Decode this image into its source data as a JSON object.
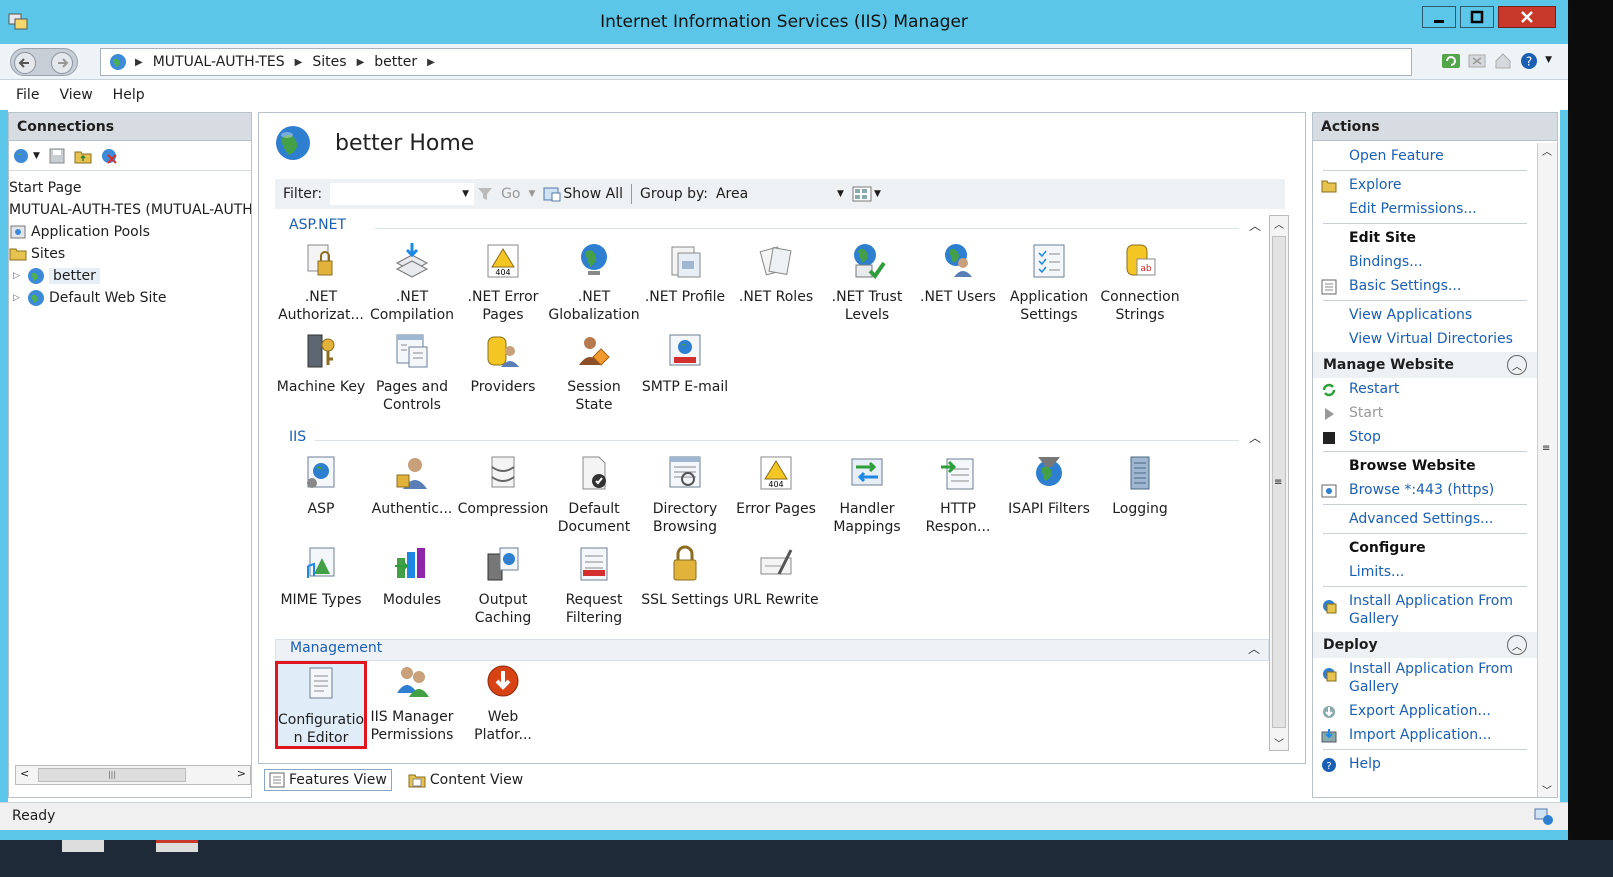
{
  "window": {
    "title": "Internet Information Services (IIS) Manager",
    "brand_color": "#5bc6e8",
    "close_color": "#c8392b"
  },
  "address": {
    "crumbs": [
      "MUTUAL-AUTH-TES",
      "Sites",
      "better"
    ]
  },
  "menu": [
    "File",
    "View",
    "Help"
  ],
  "connections": {
    "title": "Connections",
    "tree": [
      {
        "label": "Start Page",
        "icon": "start-page-icon",
        "indent": 0
      },
      {
        "label": "MUTUAL-AUTH-TES (MUTUAL-AUTH",
        "icon": "server-icon",
        "indent": 0
      },
      {
        "label": "Application Pools",
        "icon": "app-pools-icon",
        "indent": 1
      },
      {
        "label": "Sites",
        "icon": "sites-icon",
        "indent": 1
      },
      {
        "label": "better",
        "icon": "globe-icon",
        "indent": 2
      },
      {
        "label": "Default Web Site",
        "icon": "globe-icon",
        "indent": 2
      }
    ]
  },
  "home": {
    "title": "better Home",
    "filter_label": "Filter:",
    "go_label": "Go",
    "show_all_label": "Show All",
    "group_by_label": "Group by:",
    "group_by_value": "Area"
  },
  "sections": {
    "aspnet": {
      "title": "ASP.NET",
      "features": [
        {
          "line1": ".NET",
          "line2": "Authorizat..."
        },
        {
          "line1": ".NET",
          "line2": "Compilation"
        },
        {
          "line1": ".NET Error",
          "line2": "Pages"
        },
        {
          "line1": ".NET",
          "line2": "Globalization"
        },
        {
          "line1": ".NET Profile",
          "line2": ""
        },
        {
          "line1": ".NET Roles",
          "line2": ""
        },
        {
          "line1": ".NET Trust",
          "line2": "Levels"
        },
        {
          "line1": ".NET Users",
          "line2": ""
        },
        {
          "line1": "Application",
          "line2": "Settings"
        },
        {
          "line1": "Connection",
          "line2": "Strings"
        },
        {
          "line1": "Machine Key",
          "line2": ""
        },
        {
          "line1": "Pages and",
          "line2": "Controls"
        },
        {
          "line1": "Providers",
          "line2": ""
        },
        {
          "line1": "Session State",
          "line2": ""
        },
        {
          "line1": "SMTP E-mail",
          "line2": ""
        }
      ]
    },
    "iis": {
      "title": "IIS",
      "features": [
        {
          "line1": "ASP",
          "line2": ""
        },
        {
          "line1": "Authentic...",
          "line2": ""
        },
        {
          "line1": "Compression",
          "line2": ""
        },
        {
          "line1": "Default",
          "line2": "Document"
        },
        {
          "line1": "Directory",
          "line2": "Browsing"
        },
        {
          "line1": "Error Pages",
          "line2": ""
        },
        {
          "line1": "Handler",
          "line2": "Mappings"
        },
        {
          "line1": "HTTP",
          "line2": "Respon..."
        },
        {
          "line1": "ISAPI Filters",
          "line2": ""
        },
        {
          "line1": "Logging",
          "line2": ""
        },
        {
          "line1": "MIME Types",
          "line2": ""
        },
        {
          "line1": "Modules",
          "line2": ""
        },
        {
          "line1": "Output",
          "line2": "Caching"
        },
        {
          "line1": "Request",
          "line2": "Filtering"
        },
        {
          "line1": "SSL Settings",
          "line2": ""
        },
        {
          "line1": "URL Rewrite",
          "line2": ""
        }
      ]
    },
    "management": {
      "title": "Management",
      "features": [
        {
          "line1": "Configuratio",
          "line2": "n Editor"
        },
        {
          "line1": "IIS Manager",
          "line2": "Permissions"
        },
        {
          "line1": "Web",
          "line2": "Platfor..."
        }
      ]
    }
  },
  "tabs": {
    "features": "Features View",
    "content": "Content View"
  },
  "actions": {
    "title": "Actions",
    "open_feature": "Open Feature",
    "explore": "Explore",
    "edit_permissions": "Edit Permissions...",
    "edit_site": "Edit Site",
    "bindings": "Bindings...",
    "basic_settings": "Basic Settings...",
    "view_applications": "View Applications",
    "view_virtual_directories": "View Virtual Directories",
    "manage_website": "Manage Website",
    "restart": "Restart",
    "start": "Start",
    "stop": "Stop",
    "browse_website": "Browse Website",
    "browse_443": "Browse *:443 (https)",
    "advanced_settings": "Advanced Settings...",
    "configure": "Configure",
    "limits": "Limits...",
    "install_app_line1": "Install Application From",
    "install_app_line2": "Gallery",
    "deploy": "Deploy",
    "install_app2_line1": "Install Application From",
    "install_app2_line2": "Gallery",
    "export_app": "Export Application...",
    "import_app": "Import Application...",
    "help": "Help"
  },
  "status": {
    "text": "Ready"
  }
}
